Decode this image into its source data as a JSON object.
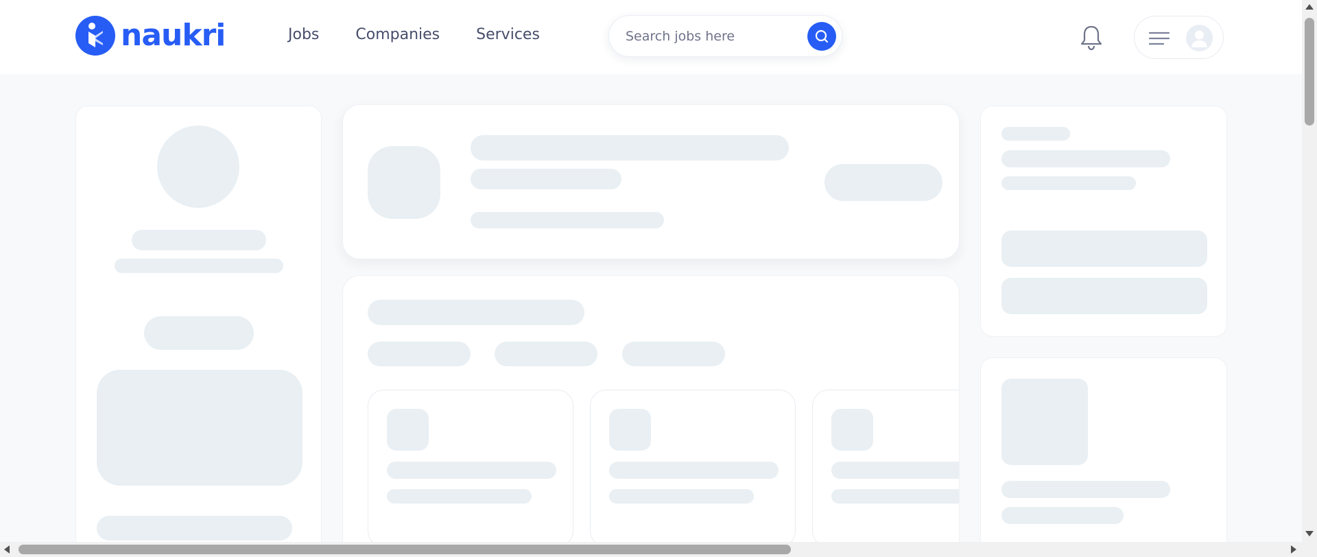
{
  "brand": {
    "name": "naukri",
    "logo_icon": "naukri-logo-icon",
    "color": "#275df5"
  },
  "nav": {
    "items": [
      {
        "label": "Jobs"
      },
      {
        "label": "Companies"
      },
      {
        "label": "Services"
      }
    ]
  },
  "search": {
    "placeholder": "Search jobs here",
    "value": "",
    "icon": "search-icon"
  },
  "header_icons": {
    "notifications": "bell-icon",
    "menu": "hamburger-menu-icon",
    "avatar": "user-avatar-icon"
  },
  "colors": {
    "skeleton": "#e9eff3",
    "background": "#f8f9fa",
    "accent": "#275df5",
    "nav_text": "#474d6a"
  }
}
